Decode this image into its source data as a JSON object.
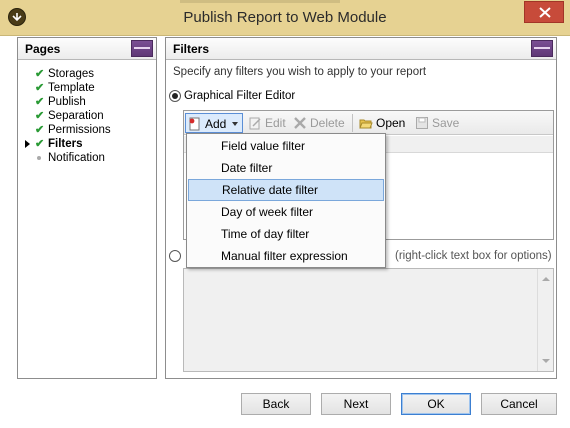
{
  "window": {
    "title": "Publish Report to Web Module",
    "close_icon": "close-icon",
    "colors": {
      "titlebar": "#e6d292",
      "close": "#c74b3a"
    }
  },
  "pages_panel": {
    "heading": "Pages",
    "items": [
      {
        "label": "Storages",
        "status": "done"
      },
      {
        "label": "Template",
        "status": "done"
      },
      {
        "label": "Publish",
        "status": "done"
      },
      {
        "label": "Separation",
        "status": "done"
      },
      {
        "label": "Permissions",
        "status": "done"
      },
      {
        "label": "Filters",
        "status": "current"
      },
      {
        "label": "Notification",
        "status": "pending"
      }
    ]
  },
  "filters_panel": {
    "heading": "Filters",
    "description": "Specify any filters you wish to apply to your report",
    "graphical_option": "Graphical Filter Editor",
    "expression_hint": "(right-click text box for options)",
    "toolbar": {
      "add": "Add",
      "edit": "Edit",
      "delete": "Delete",
      "open": "Open",
      "save": "Save"
    },
    "add_menu": {
      "items": [
        "Field value filter",
        "Date filter",
        "Relative date filter",
        "Day of week filter",
        "Time of day filter",
        "Manual filter expression"
      ],
      "selected_index": 2
    }
  },
  "buttons": {
    "back": "Back",
    "next": "Next",
    "ok": "OK",
    "cancel": "Cancel"
  }
}
